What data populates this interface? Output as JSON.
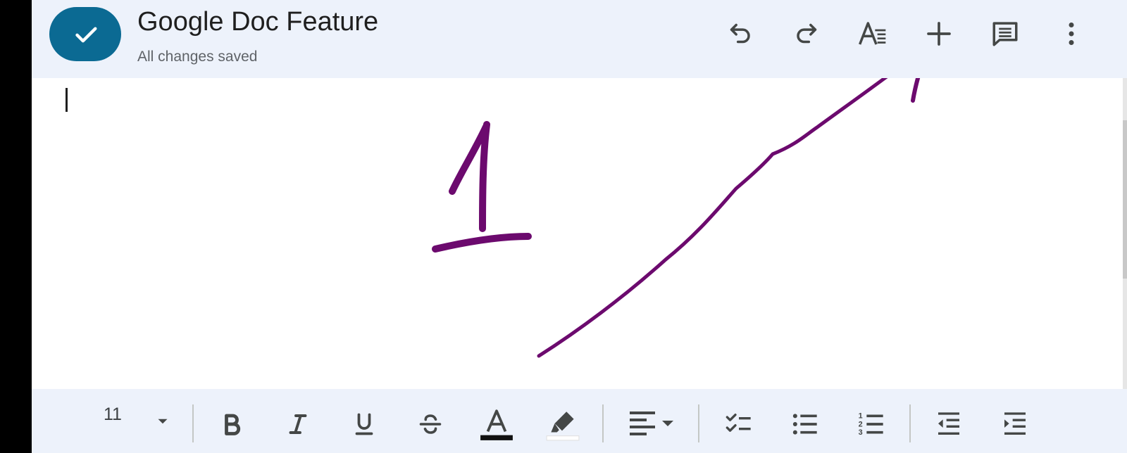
{
  "document": {
    "title": "Google Doc Feature",
    "status": "All changes saved"
  },
  "toolbar": {
    "done_icon": "check-icon",
    "actions": [
      "undo-icon",
      "redo-icon",
      "text-format-icon",
      "insert-plus-icon",
      "comment-icon",
      "more-vert-icon"
    ]
  },
  "formatting": {
    "font_size": "11",
    "tools": [
      "bold",
      "italic",
      "underline",
      "strikethrough",
      "text-color",
      "highlight",
      "align-left",
      "checklist",
      "bulleted-list",
      "numbered-list",
      "decrease-indent",
      "increase-indent"
    ]
  },
  "annotation": {
    "number": "1",
    "color": "#6c0a6e",
    "points_to": "insert-plus-icon"
  },
  "colors": {
    "accent": "#0b6a93",
    "bar_background": "#edf2fb",
    "icon": "#444746"
  }
}
